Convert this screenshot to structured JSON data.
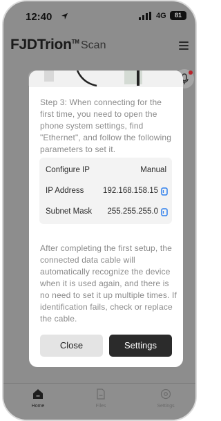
{
  "status_bar": {
    "time": "12:40",
    "network": "4G",
    "battery": "81"
  },
  "header": {
    "brand": "FJDTrion",
    "trademark": "TM",
    "subtitle": "Scan"
  },
  "dialog": {
    "step_text": "Step 3: When connecting for the first time, you need to open the phone system settings, find \"Ethernet\", and follow the following parameters to set it.",
    "params": [
      {
        "label": "Configure IP",
        "value": "Manual"
      },
      {
        "label": "IP Address",
        "value": "192.168.158.15"
      },
      {
        "label": "Subnet Mask",
        "value": "255.255.255.0"
      }
    ],
    "after_text": "After completing the first setup, the connected data cable will automatically recognize the device when it is used again, and there is no need to set it up multiple times. If identification fails, check or replace the cable.",
    "close_label": "Close",
    "settings_label": "Settings"
  },
  "bottom_nav": [
    {
      "label": "Home",
      "icon": "home-icon"
    },
    {
      "label": "Files",
      "icon": "file-icon"
    },
    {
      "label": "Settings",
      "icon": "settings-icon"
    }
  ],
  "colors": {
    "overlay": "#8d8d8d",
    "primary_button": "#2b2b2b",
    "secondary_button": "#e4e4e4",
    "copy_icon": "#2f80ed",
    "notification_dot": "#b9232b"
  }
}
